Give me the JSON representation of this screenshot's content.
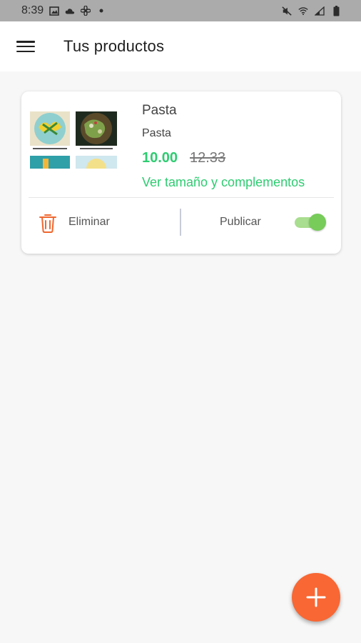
{
  "status_bar": {
    "time": "8:39",
    "icons_left": [
      "image-icon",
      "cloud-icon",
      "fan-icon",
      "dot-icon"
    ],
    "icons_right": [
      "mute-icon",
      "wifi-icon",
      "signal-icon",
      "battery-icon"
    ]
  },
  "app_bar": {
    "title": "Tus productos",
    "menu_icon": "menu-icon"
  },
  "products": [
    {
      "name": "Pasta",
      "subtitle": "Pasta",
      "price": "10.00",
      "old_price": "12.33",
      "details_link": "Ver tamaño y complementos",
      "delete_label": "Eliminar",
      "publish_label": "Publicar",
      "published": true
    }
  ],
  "fab": {
    "icon": "plus-icon"
  },
  "colors": {
    "accent_green": "#2ecc71",
    "fab": "#f86734",
    "delete_icon": "#f0672f",
    "toggle_on": "#77cc5a"
  }
}
